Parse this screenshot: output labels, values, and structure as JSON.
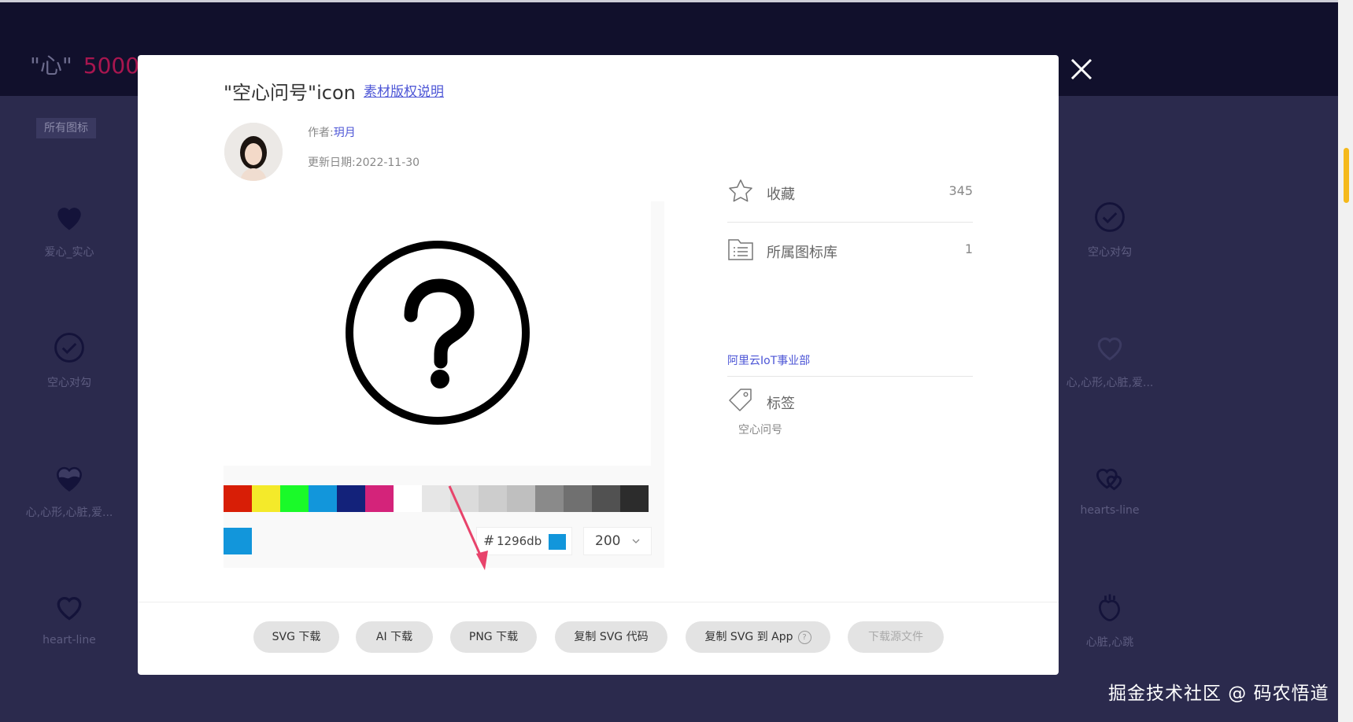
{
  "background": {
    "title_prefix": "\"心\"",
    "title_count": "5000",
    "filter_label": "所有图标",
    "left_cells": [
      "爱心_实心",
      "空心对勾",
      "心,心形,心脏,爱...",
      "heart-line"
    ],
    "right_cells": [
      "空心对勾",
      "心,心形,心脏,爱...",
      "hearts-line",
      "心脏,心跳"
    ]
  },
  "modal": {
    "title": "\"空心问号\"icon",
    "copyright_link": "素材版权说明",
    "author_label": "作者:",
    "author_name": "玥月",
    "date_label": "更新日期:",
    "date_value": "2022-11-30",
    "swatch_colors": [
      "#d81e06",
      "#f4ea2a",
      "#1afa29",
      "#1296db",
      "#13227a",
      "#d4237a",
      "#ffffff",
      "#e6e6e6",
      "#dbdbdb",
      "#cdcdcd",
      "#bfbfbf",
      "#8a8a8a",
      "#707070",
      "#515151",
      "#2c2c2c"
    ],
    "current_color": "#1296db",
    "hex_symbol": "#",
    "hex_value": "1296db",
    "size_value": "200",
    "favorites_label": "收藏",
    "favorites_count": "345",
    "library_label": "所属图标库",
    "library_count": "1",
    "library_name": "阿里云IoT事业部",
    "tags_label": "标签",
    "tag": "空心问号",
    "buttons": {
      "svg_download": "SVG 下载",
      "ai_download": "AI 下载",
      "png_download": "PNG 下载",
      "copy_svg_code": "复制 SVG 代码",
      "copy_svg_to_app": "复制 SVG 到 App",
      "download_source": "下载源文件"
    }
  },
  "watermark": "掘金技术社区 @ 码农悟道"
}
